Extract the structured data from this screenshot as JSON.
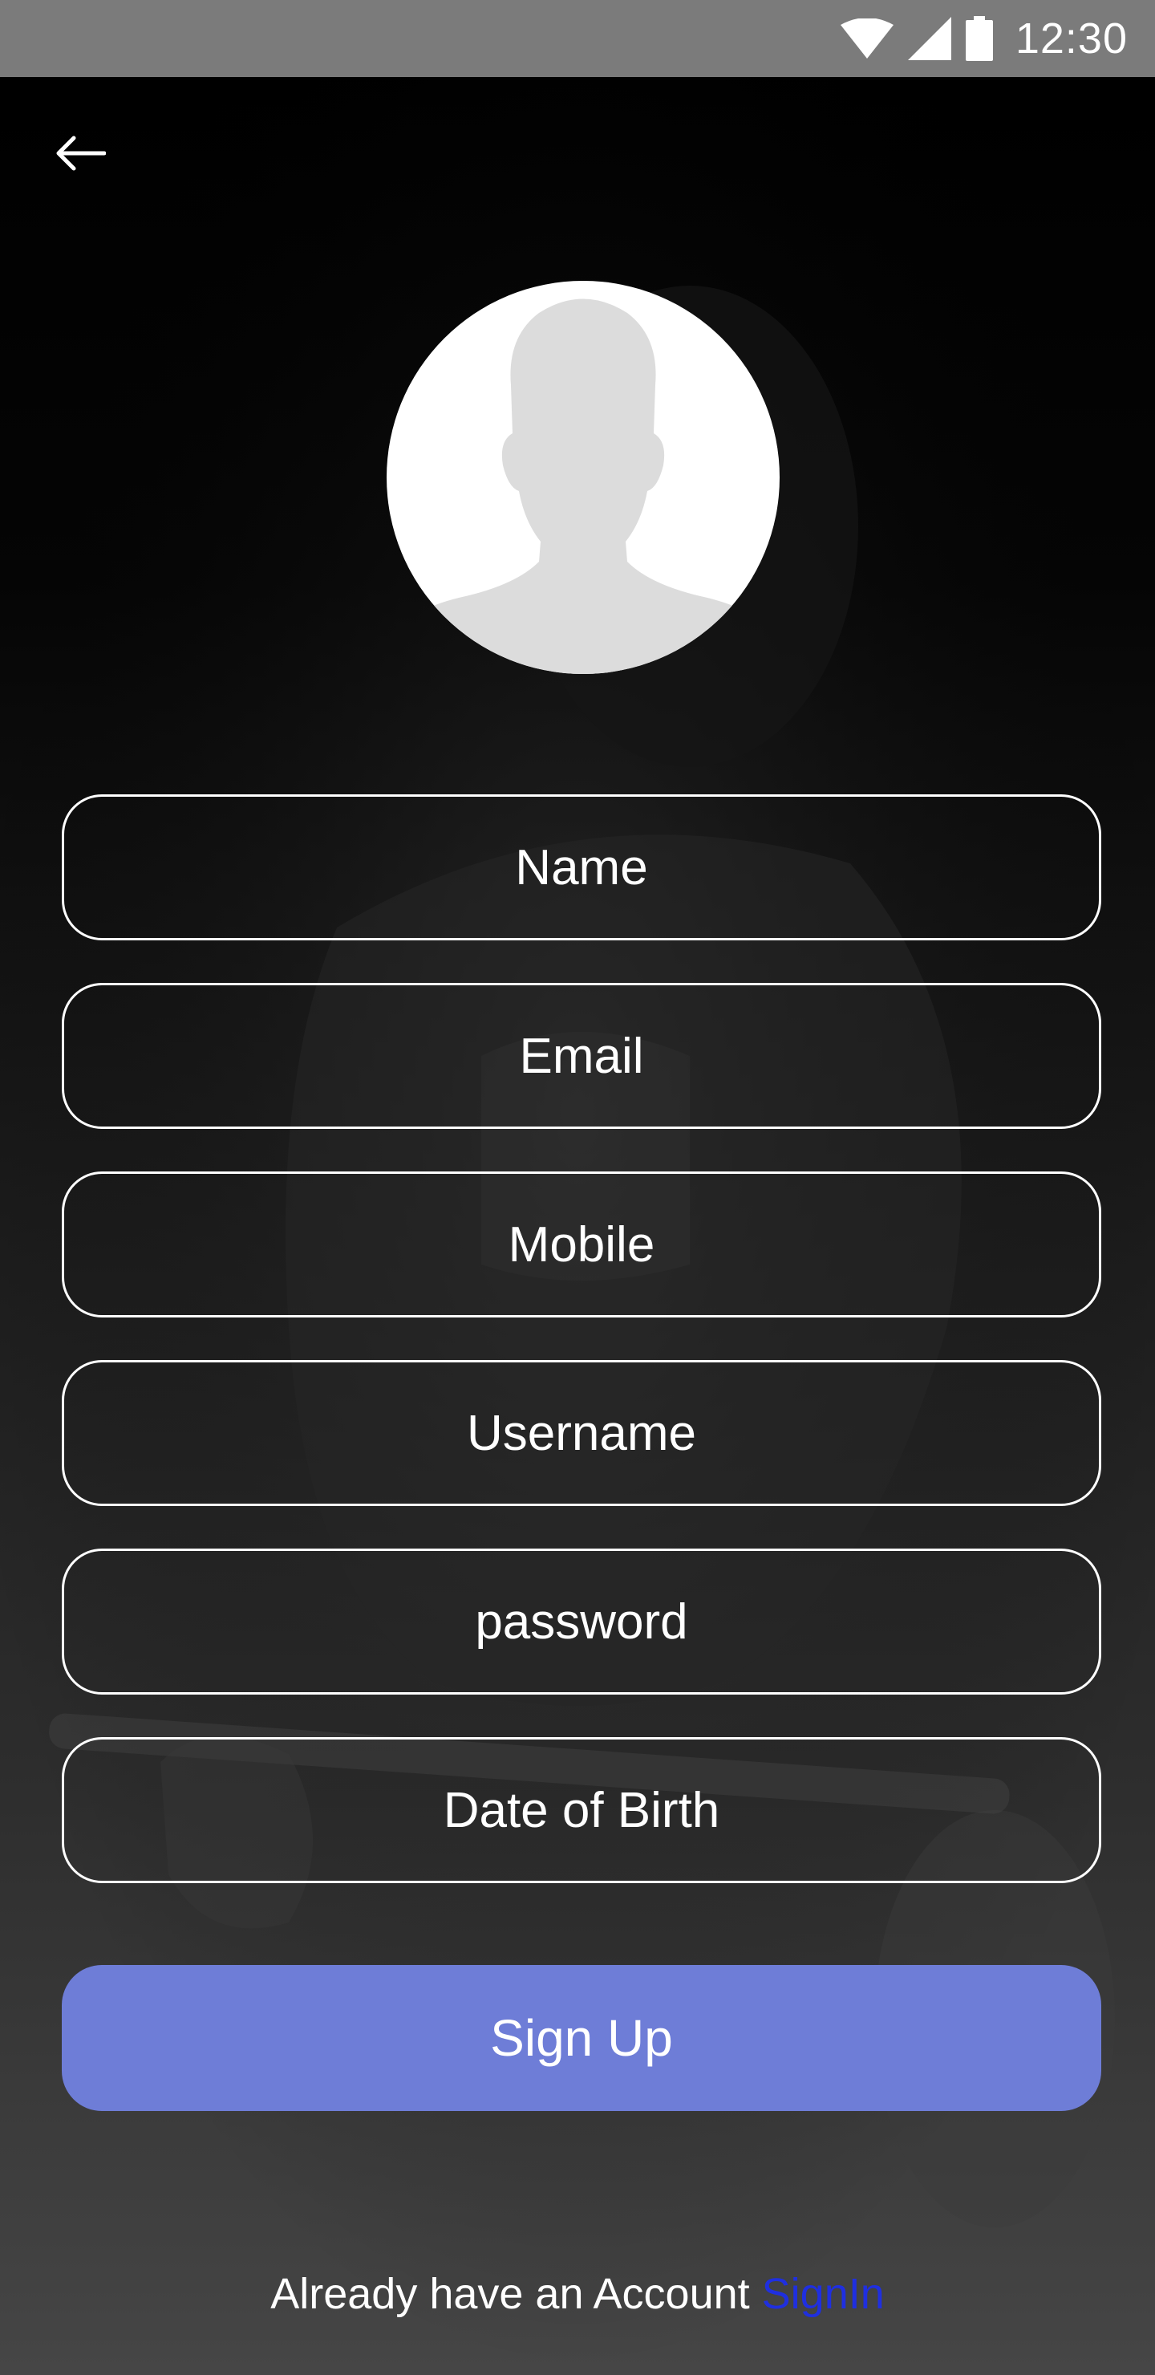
{
  "status_bar": {
    "time": "12:30",
    "icons": [
      "wifi-icon",
      "signal-icon",
      "battery-icon"
    ]
  },
  "navigation": {
    "back_icon": "arrow-left-icon"
  },
  "avatar": {
    "icon": "person-silhouette-icon"
  },
  "form": {
    "name_placeholder": "Name",
    "email_placeholder": "Email",
    "mobile_placeholder": "Mobile",
    "username_placeholder": "Username",
    "password_placeholder": "password",
    "dob_placeholder": "Date of Birth"
  },
  "signup_label": "Sign Up",
  "footer": {
    "prompt": "Already have an Account ",
    "signin_label": "SignIn"
  },
  "colors": {
    "status_bar": "#7b7b7b",
    "accent_button": "#6e7dd7",
    "link": "#1f2fe0",
    "field_border": "#ffffff"
  }
}
